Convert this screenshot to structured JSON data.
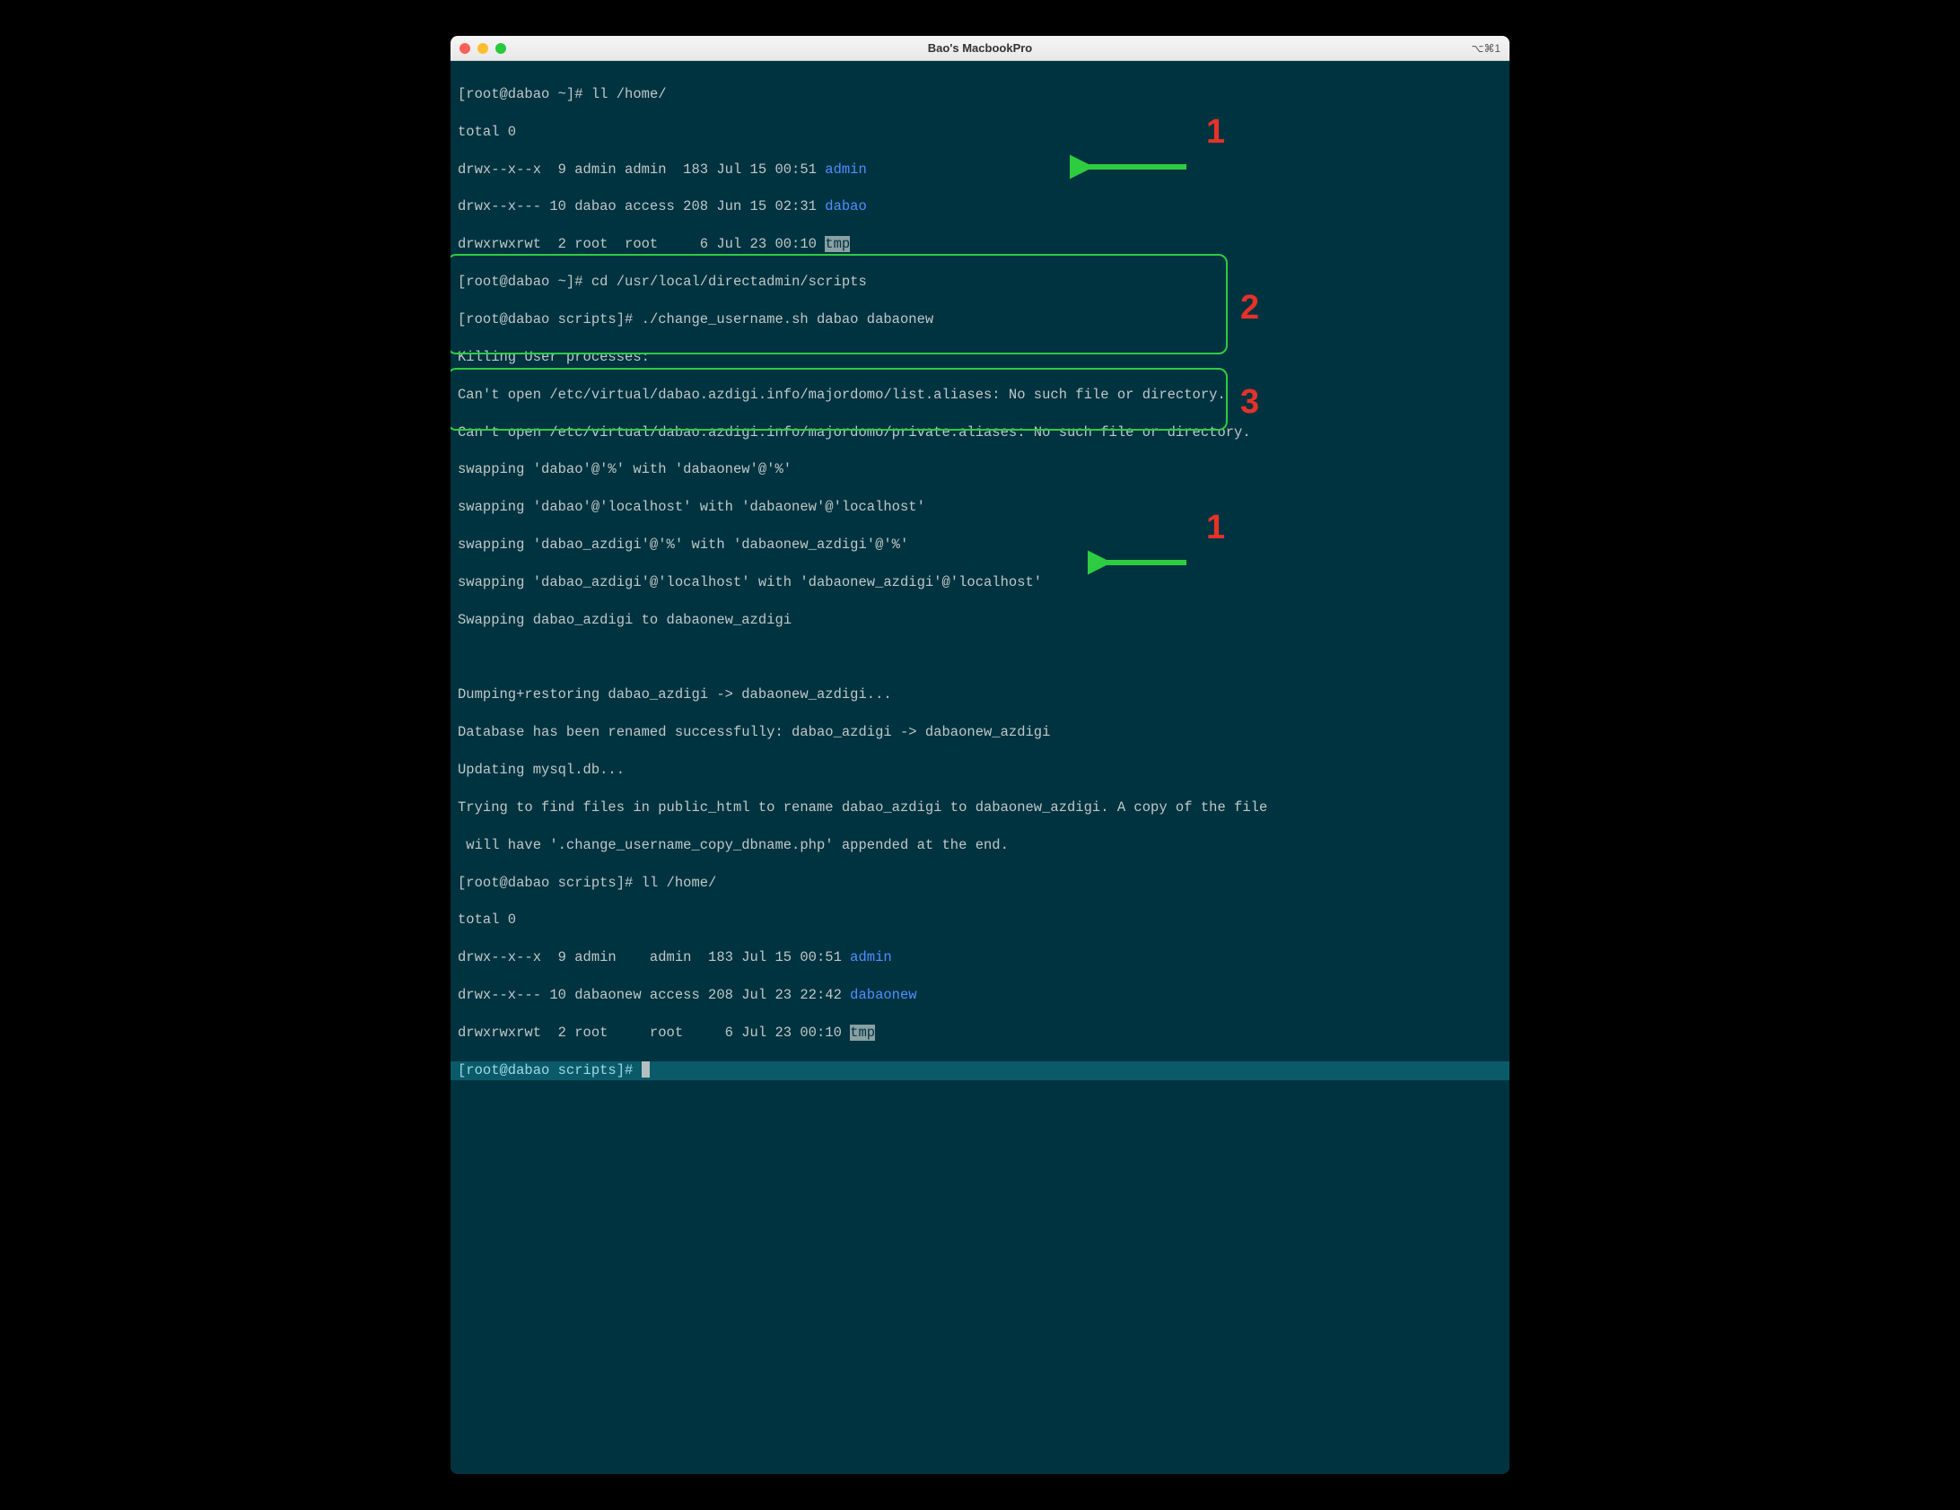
{
  "window": {
    "title": "Bao's MacbookPro",
    "tab_indicator": "⌥⌘1"
  },
  "lines": {
    "l0_prompt": "[root@dabao ~]# ",
    "l0_cmd": "ll /home/",
    "l1": "total 0",
    "l2a": "drwx--x--x  9 admin admin  183 Jul 15 00:51 ",
    "l2b": "admin",
    "l3a": "drwx--x--- 10 dabao access 208 Jun 15 02:31 ",
    "l3b": "dabao",
    "l4a": "drwxrwxrwt  2 root  root     6 Jul 23 00:10 ",
    "l4b": "tmp",
    "l5_prompt": "[root@dabao ~]# ",
    "l5_cmd": "cd /usr/local/directadmin/scripts",
    "l6_prompt": "[root@dabao scripts]# ",
    "l6_cmd": "./change_username.sh dabao dabaonew",
    "l7": "Killing User processes:",
    "l8": "Can't open /etc/virtual/dabao.azdigi.info/majordomo/list.aliases: No such file or directory.",
    "l9": "Can't open /etc/virtual/dabao.azdigi.info/majordomo/private.aliases: No such file or directory.",
    "l10": "swapping 'dabao'@'%' with 'dabaonew'@'%'",
    "l11": "swapping 'dabao'@'localhost' with 'dabaonew'@'localhost'",
    "l12": "swapping 'dabao_azdigi'@'%' with 'dabaonew_azdigi'@'%'",
    "l13": "swapping 'dabao_azdigi'@'localhost' with 'dabaonew_azdigi'@'localhost'",
    "l14": "Swapping dabao_azdigi to dabaonew_azdigi",
    "blank": " ",
    "l15": "Dumping+restoring dabao_azdigi -> dabaonew_azdigi...",
    "l16": "Database has been renamed successfully: dabao_azdigi -> dabaonew_azdigi",
    "l17": "Updating mysql.db...",
    "l18": "Trying to find files in public_html to rename dabao_azdigi to dabaonew_azdigi. A copy of the file",
    "l19": " will have '.change_username_copy_dbname.php' appended at the end.",
    "l20_prompt": "[root@dabao scripts]# ",
    "l20_cmd": "ll /home/",
    "l21": "total 0",
    "l22a": "drwx--x--x  9 admin    admin  183 Jul 15 00:51 ",
    "l22b": "admin",
    "l23a": "drwx--x--- 10 dabaonew access 208 Jul 23 22:42 ",
    "l23b": "dabaonew",
    "l24a": "drwxrwxrwt  2 root     root     6 Jul 23 00:10 ",
    "l24b": "tmp",
    "l25_prompt": "[root@dabao scripts]# "
  },
  "annotations": {
    "label1": "1",
    "label2": "2",
    "label3": "3",
    "label1b": "1"
  }
}
